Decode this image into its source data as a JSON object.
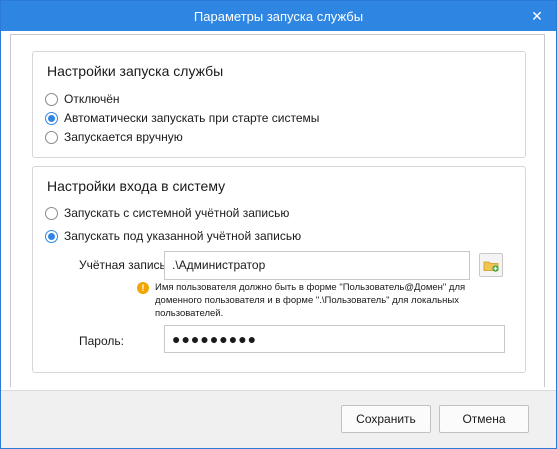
{
  "window": {
    "title": "Параметры запуска службы",
    "close_icon": "close-icon"
  },
  "startup_group": {
    "title": "Настройки запуска службы",
    "options": [
      {
        "label": "Отключён",
        "checked": false
      },
      {
        "label": "Автоматически запускать при старте системы",
        "checked": true
      },
      {
        "label": "Запускается вручную",
        "checked": false
      }
    ]
  },
  "logon_group": {
    "title": "Настройки входа в систему",
    "options": [
      {
        "label": "Запускать с системной учётной записью",
        "checked": false
      },
      {
        "label": "Запускать под указанной учётной записью",
        "checked": true
      }
    ],
    "account_label": "Учётная запись:",
    "account_value": ".\\Администратор",
    "browse_icon": "folder-user-icon",
    "info_icon": "warning-icon",
    "info_text": "Имя пользователя должно быть в форме \"Пользователь@Домен\" для доменного пользователя и в форме \".\\Пользователь\" для локальных пользователей.",
    "password_label": "Пароль:",
    "password_value": "●●●●●●●●●"
  },
  "footer": {
    "save_label": "Сохранить",
    "cancel_label": "Отмена"
  },
  "colors": {
    "accent": "#2f86e2",
    "warning": "#f0a500"
  }
}
